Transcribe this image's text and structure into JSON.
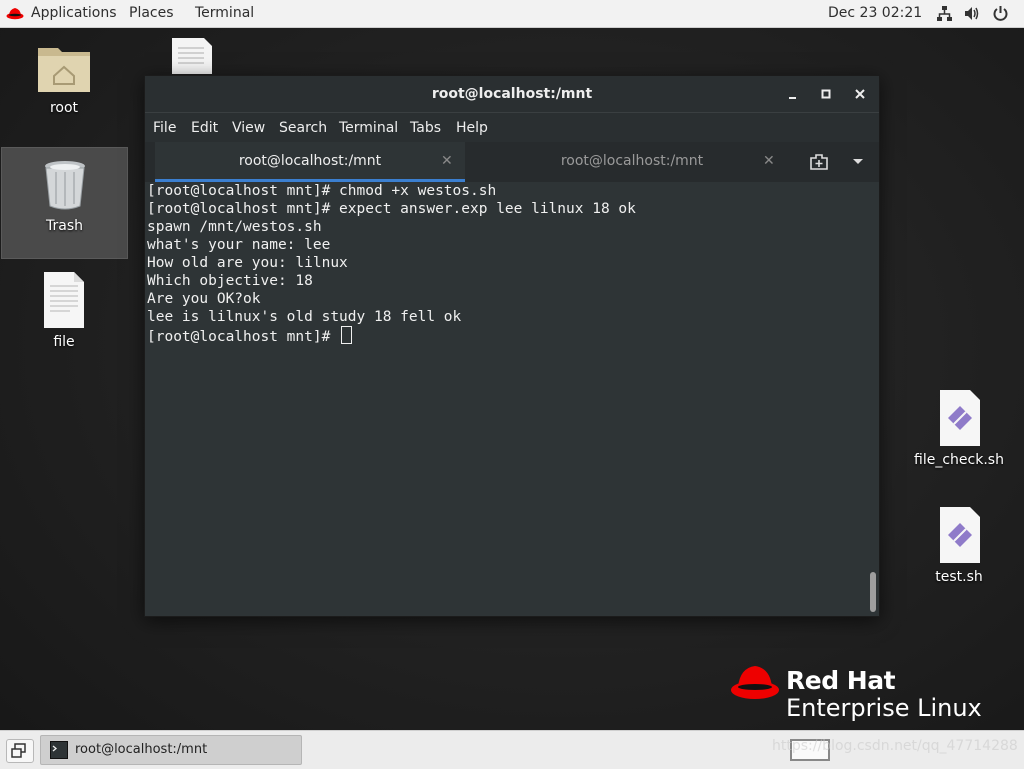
{
  "topbar": {
    "applications": "Applications",
    "places": "Places",
    "terminal": "Terminal",
    "clock": "Dec 23  02:21",
    "icons": [
      "redhat-icon",
      "network-icon",
      "volume-icon",
      "power-icon"
    ]
  },
  "desktop": {
    "icons": {
      "root": "root",
      "trash": "Trash",
      "file": "file",
      "file_check": "file_check.sh",
      "test": "test.sh"
    }
  },
  "terminal": {
    "title": "root@localhost:/mnt",
    "menu": [
      "File",
      "Edit",
      "View",
      "Search",
      "Terminal",
      "Tabs",
      "Help"
    ],
    "tabs": [
      {
        "label": "root@localhost:/mnt",
        "active": true
      },
      {
        "label": "root@localhost:/mnt",
        "active": false
      }
    ],
    "lines": [
      "[root@localhost mnt]# chmod +x westos.sh",
      "[root@localhost mnt]# expect answer.exp lee lilnux 18 ok",
      "spawn /mnt/westos.sh",
      "what's your name: lee",
      "How old are you: lilnux",
      "Which objective: 18",
      "Are you OK?ok",
      "lee is lilnux's old study 18 fell ok",
      "[root@localhost mnt]# "
    ]
  },
  "branding": {
    "line1": "Red Hat",
    "line2": "Enterprise Linux",
    "accent": "#ee0000"
  },
  "taskbar": {
    "window_label": "root@localhost:/mnt",
    "watermark": "https://blog.csdn.net/qq_47714288"
  }
}
